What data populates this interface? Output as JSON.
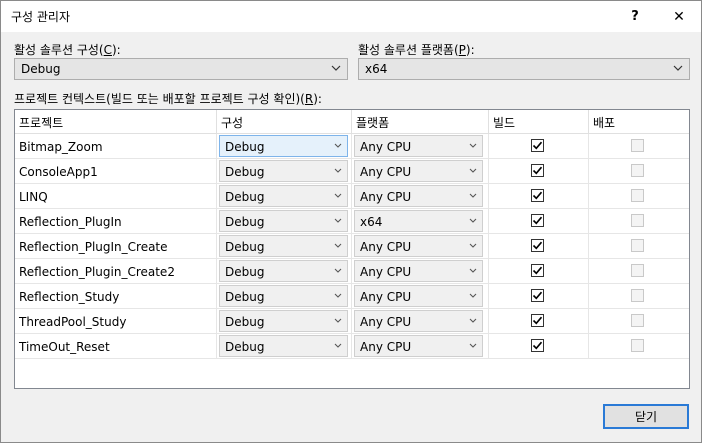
{
  "window": {
    "title": "구성 관리자",
    "help_label": "?",
    "close_label": "✕"
  },
  "active_config": {
    "label_prefix": "활성 솔루션 구성(",
    "mnemonic": "C",
    "label_suffix": "):",
    "value": "Debug"
  },
  "active_platform": {
    "label_prefix": "활성 솔루션 플랫폼(",
    "mnemonic": "P",
    "label_suffix": "):",
    "value": "x64"
  },
  "contexts": {
    "label_prefix": "프로젝트 컨텍스트(빌드 또는 배포할 프로젝트 구성 확인)(",
    "mnemonic": "R",
    "label_suffix": "):"
  },
  "columns": {
    "project": "프로젝트",
    "config": "구성",
    "platform": "플랫폼",
    "build": "빌드",
    "deploy": "배포"
  },
  "rows": [
    {
      "project": "Bitmap_Zoom",
      "config": "Debug",
      "platform": "Any CPU",
      "build": true,
      "deploy": false
    },
    {
      "project": "ConsoleApp1",
      "config": "Debug",
      "platform": "Any CPU",
      "build": true,
      "deploy": false
    },
    {
      "project": "LINQ",
      "config": "Debug",
      "platform": "Any CPU",
      "build": true,
      "deploy": false
    },
    {
      "project": "Reflection_PlugIn",
      "config": "Debug",
      "platform": "x64",
      "build": true,
      "deploy": false
    },
    {
      "project": "Reflection_PlugIn_Create",
      "config": "Debug",
      "platform": "Any CPU",
      "build": true,
      "deploy": false
    },
    {
      "project": "Reflection_Plugin_Create2",
      "config": "Debug",
      "platform": "Any CPU",
      "build": true,
      "deploy": false
    },
    {
      "project": "Reflection_Study",
      "config": "Debug",
      "platform": "Any CPU",
      "build": true,
      "deploy": false
    },
    {
      "project": "ThreadPool_Study",
      "config": "Debug",
      "platform": "Any CPU",
      "build": true,
      "deploy": false
    },
    {
      "project": "TimeOut_Reset",
      "config": "Debug",
      "platform": "Any CPU",
      "build": true,
      "deploy": false
    }
  ],
  "buttons": {
    "close": "닫기"
  },
  "colors": {
    "accent": "#2a7ad6",
    "selected_cell": "#e5f1fb"
  }
}
